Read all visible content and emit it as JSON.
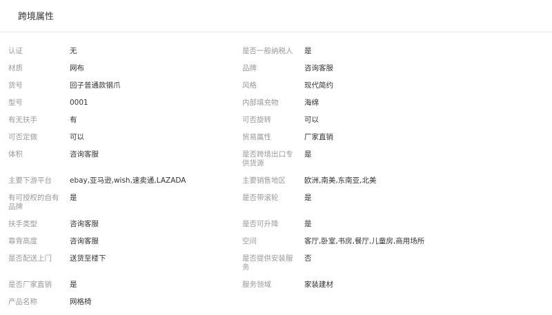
{
  "header": {
    "title": "跨境属性"
  },
  "rows": [
    {
      "left": {
        "label": "认证",
        "value": "无"
      },
      "right": {
        "label": "是否一般纳税人",
        "value": "是"
      }
    },
    {
      "left": {
        "label": "材质",
        "value": "网布"
      },
      "right": {
        "label": "品牌",
        "value": "咨询客服"
      }
    },
    {
      "left": {
        "label": "货号",
        "value": "回子普通款钢爪"
      },
      "right": {
        "label": "风格",
        "value": "现代简约"
      }
    },
    {
      "left": {
        "label": "型号",
        "value": "0001"
      },
      "right": {
        "label": "内部填充物",
        "value": "海绵"
      }
    },
    {
      "left": {
        "label": "有无扶手",
        "value": "有"
      },
      "right": {
        "label": "可否旋转",
        "value": "可以"
      }
    },
    {
      "left": {
        "label": "可否定做",
        "value": "可以"
      },
      "right": {
        "label": "贸易属性",
        "value": "厂家直销"
      }
    },
    {
      "left": {
        "label": "体积",
        "value": "咨询客服"
      },
      "right": {
        "label": "是否跨境出口专供货源",
        "value": "是"
      }
    },
    {
      "left": {
        "label": "主要下游平台",
        "value": "ebay,亚马逊,wish,速卖通,LAZADA"
      },
      "right": {
        "label": "主要销售地区",
        "value": "欧洲,南美,东南亚,北美"
      }
    },
    {
      "left": {
        "label": "有可授权的自有品牌",
        "value": "是"
      },
      "right": {
        "label": "是否带滚轮",
        "value": "是"
      }
    },
    {
      "left": {
        "label": "扶手类型",
        "value": "咨询客服"
      },
      "right": {
        "label": "是否可升降",
        "value": "是"
      }
    },
    {
      "left": {
        "label": "靠背高度",
        "value": "咨询客服"
      },
      "right": {
        "label": "空间",
        "value": "客厅,卧室,书房,餐厅,儿童房,商用场所"
      }
    },
    {
      "left": {
        "label": "是否配送上门",
        "value": "送货至楼下"
      },
      "right": {
        "label": "是否提供安装服务",
        "value": "否"
      }
    },
    {
      "left": {
        "label": "是否厂家直销",
        "value": "是"
      },
      "right": {
        "label": "服务领域",
        "value": "家装建材"
      }
    },
    {
      "left": {
        "label": "产品名称",
        "value": "网格椅"
      }
    }
  ]
}
